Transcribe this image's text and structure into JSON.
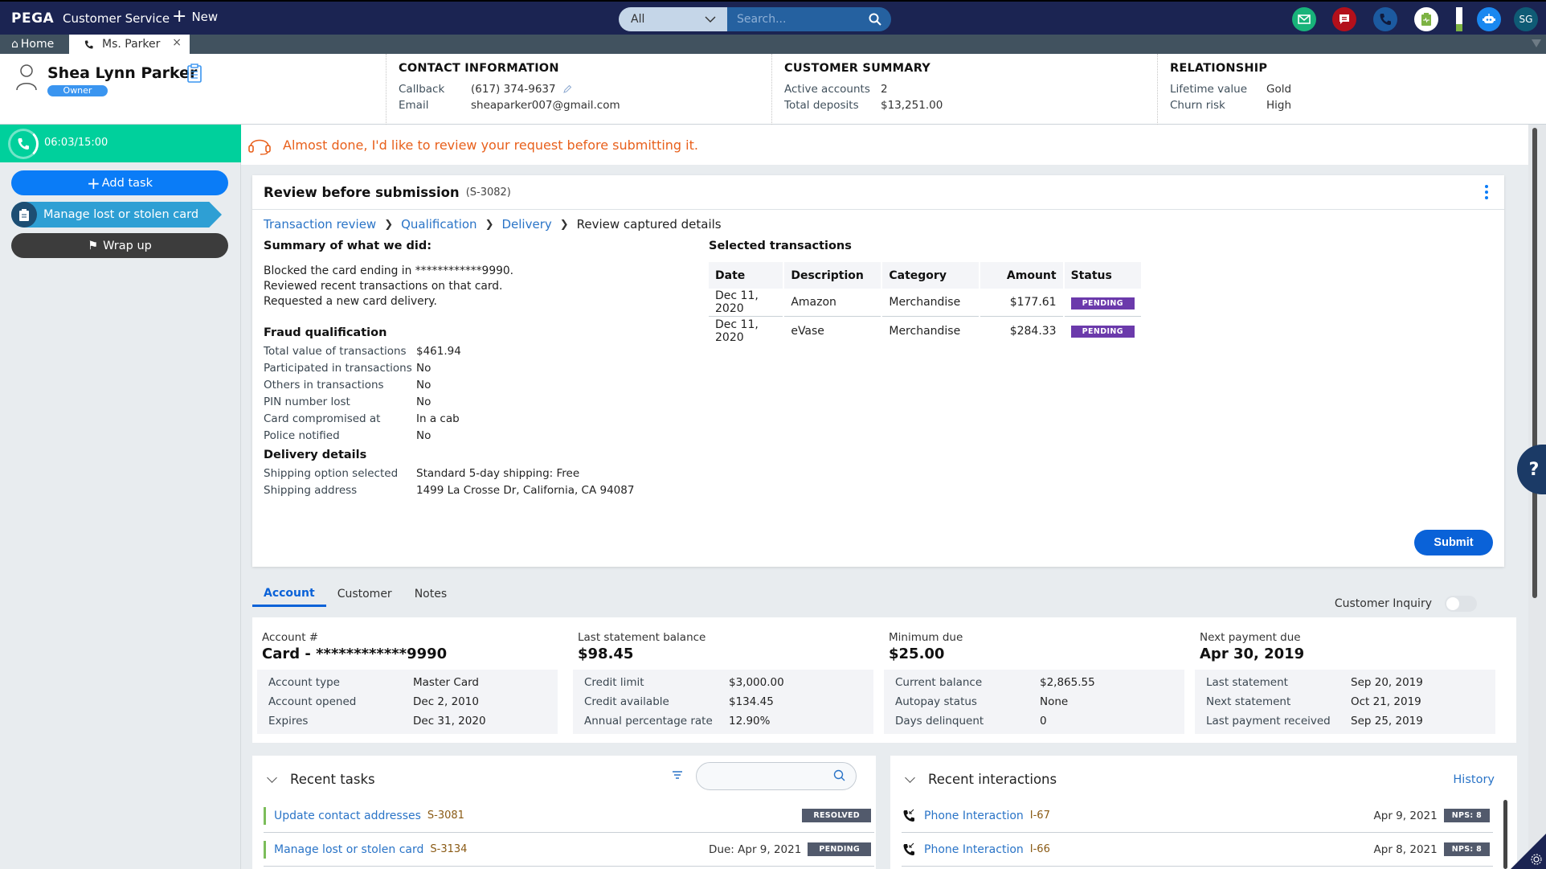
{
  "topbar": {
    "brand": "PEGA",
    "app_name": "Customer Service",
    "new_label": "New",
    "search_scope": "All",
    "search_placeholder": "Search...",
    "avatar_initials": "SG",
    "battery_level": 0.3,
    "icons": [
      "email-icon",
      "chat-icon",
      "phone-icon",
      "clipboard-pulse-icon",
      "bot-icon"
    ]
  },
  "tabs": {
    "home": "Home",
    "active": "Ms. Parker"
  },
  "customer": {
    "name": "Shea Lynn Parker",
    "role": "Owner"
  },
  "contact": {
    "title": "CONTACT INFORMATION",
    "callback_label": "Callback",
    "callback": "(617) 374-9637",
    "email_label": "Email",
    "email": "sheaparker007@gmail.com"
  },
  "summary": {
    "title": "CUSTOMER SUMMARY",
    "active_label": "Active accounts",
    "active": "2",
    "deposits_label": "Total deposits",
    "deposits": "$13,251.00"
  },
  "relationship": {
    "title": "RELATIONSHIP",
    "ltv_label": "Lifetime value",
    "ltv": "Gold",
    "churn_label": "Churn risk",
    "churn": "High"
  },
  "sidebar": {
    "timer": "06:03/15:00",
    "timer_progress": 0.4,
    "add_task": "Add task",
    "current_task": "Manage lost or stolen card",
    "wrap_up": "Wrap up"
  },
  "banner": {
    "message": "Almost done, I'd like to review your request before submitting it."
  },
  "review": {
    "title": "Review before submission",
    "case_id": "(S-3082)",
    "breadcrumbs": [
      "Transaction review",
      "Qualification",
      "Delivery"
    ],
    "current_step": "Review captured details",
    "summary_title": "Summary of what we did:",
    "summary_lines": [
      "Blocked the card ending in ************9990.",
      "Reviewed recent transactions on that card.",
      "Requested a new card delivery."
    ],
    "fraud_title": "Fraud qualification",
    "fraud": [
      {
        "k": "Total value of transactions",
        "v": "$461.94"
      },
      {
        "k": "Participated in transactions",
        "v": "No"
      },
      {
        "k": "Others in transactions",
        "v": "No"
      },
      {
        "k": "PIN number lost",
        "v": "No"
      },
      {
        "k": "Card compromised at",
        "v": "In a cab"
      },
      {
        "k": "Police notified",
        "v": "No"
      }
    ],
    "delivery_title": "Delivery details",
    "delivery": [
      {
        "k": "Shipping option selected",
        "v": "Standard 5-day shipping: Free"
      },
      {
        "k": "Shipping address",
        "v": "1499 La Crosse Dr, California, CA 94087"
      }
    ],
    "tx_title": "Selected transactions",
    "tx_headers": [
      "Date",
      "Description",
      "Category",
      "Amount",
      "Status"
    ],
    "tx_rows": [
      {
        "date": "Dec 11, 2020",
        "desc": "Amazon",
        "cat": "Merchandise",
        "amount": "$177.61",
        "status": "PENDING"
      },
      {
        "date": "Dec 11, 2020",
        "desc": "eVase",
        "cat": "Merchandise",
        "amount": "$284.33",
        "status": "PENDING"
      }
    ],
    "submit": "Submit"
  },
  "lower_tabs": [
    "Account",
    "Customer",
    "Notes"
  ],
  "customer_inquiry": "Customer Inquiry",
  "account": {
    "cols": [
      {
        "label": "Account #",
        "big": "Card - ************9990",
        "rows": [
          {
            "k": "Account type",
            "v": "Master Card"
          },
          {
            "k": "Account opened",
            "v": "Dec 2, 2010"
          },
          {
            "k": "Expires",
            "v": "Dec 31, 2020"
          }
        ]
      },
      {
        "label": "Last statement balance",
        "big": "$98.45",
        "rows": [
          {
            "k": "Credit limit",
            "v": "$3,000.00"
          },
          {
            "k": "Credit available",
            "v": "$134.45"
          },
          {
            "k": "Annual percentage rate",
            "v": "12.90%"
          }
        ]
      },
      {
        "label": "Minimum due",
        "big": "$25.00",
        "rows": [
          {
            "k": "Current balance",
            "v": "$2,865.55"
          },
          {
            "k": "Autopay status",
            "v": "None"
          },
          {
            "k": "Days delinquent",
            "v": "0"
          }
        ]
      },
      {
        "label": "Next payment due",
        "big": "Apr 30, 2019",
        "rows": [
          {
            "k": "Last statement",
            "v": "Sep 20, 2019"
          },
          {
            "k": "Next statement",
            "v": "Oct 21, 2019"
          },
          {
            "k": "Last payment received",
            "v": "Sep 25, 2019"
          }
        ]
      }
    ]
  },
  "recent_tasks": {
    "title": "Recent tasks",
    "items": [
      {
        "name": "Update contact addresses",
        "id": "S-3081",
        "due": "",
        "status": "RESOLVED"
      },
      {
        "name": "Manage lost or stolen card",
        "id": "S-3134",
        "due": "Due: Apr 9, 2021",
        "status": "PENDING"
      }
    ]
  },
  "recent_interactions": {
    "title": "Recent interactions",
    "history": "History",
    "items": [
      {
        "name": "Phone Interaction",
        "id": "I-67",
        "date": "Apr 9, 2021",
        "nps": "NPS: 8"
      },
      {
        "name": "Phone Interaction",
        "id": "I-66",
        "date": "Apr 8, 2021",
        "nps": "NPS: 8"
      }
    ]
  },
  "colors": {
    "navy": "#1b2452",
    "timer_green": "#00d09c",
    "primary_blue": "#0a7cf7",
    "banner_orange": "#e8601c",
    "pending_purple": "#6b3aab"
  }
}
